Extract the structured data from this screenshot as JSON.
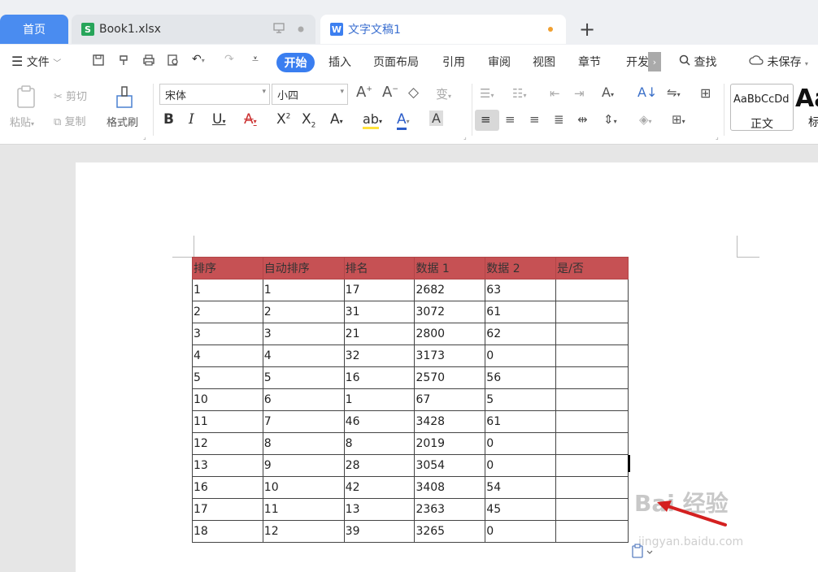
{
  "tabs": {
    "home": "首页",
    "book": "Book1.xlsx",
    "book_icon": "S",
    "doc": "文字文稿1",
    "doc_icon": "W",
    "new_tab": "+"
  },
  "menu": {
    "file": "文件",
    "items": [
      "开始",
      "插入",
      "页面布局",
      "引用",
      "审阅",
      "视图",
      "章节",
      "开发"
    ],
    "search": "查找",
    "save_status": "未保存"
  },
  "ribbon": {
    "paste": "粘贴",
    "cut": "剪切",
    "copy": "复制",
    "format_painter": "格式刷",
    "font_name": "宋体",
    "font_size": "小四",
    "style_sample": "AaBbCcDd",
    "style_name": "正文",
    "style_big": "Aa",
    "style_big_name": "标"
  },
  "table": {
    "headers": [
      "排序",
      "自动排序",
      "排名",
      "数据 1",
      "数据 2",
      "是/否"
    ],
    "rows": [
      [
        "1",
        "1",
        "17",
        "2682",
        "63",
        ""
      ],
      [
        "2",
        "2",
        "31",
        "3072",
        "61",
        ""
      ],
      [
        "3",
        "3",
        "21",
        "2800",
        "62",
        ""
      ],
      [
        "4",
        "4",
        "32",
        "3173",
        "0",
        ""
      ],
      [
        "5",
        "5",
        "16",
        "2570",
        "56",
        ""
      ],
      [
        "10",
        "6",
        "1",
        "67",
        "5",
        ""
      ],
      [
        "11",
        "7",
        "46",
        "3428",
        "61",
        ""
      ],
      [
        "12",
        "8",
        "8",
        "2019",
        "0",
        ""
      ],
      [
        "13",
        "9",
        "28",
        "3054",
        "0",
        ""
      ],
      [
        "16",
        "10",
        "42",
        "3408",
        "54",
        ""
      ],
      [
        "17",
        "11",
        "13",
        "2363",
        "45",
        ""
      ],
      [
        "18",
        "12",
        "39",
        "3265",
        "0",
        ""
      ]
    ]
  },
  "watermark": {
    "text": "Bai 经验",
    "url": "jingyan.baidu.com"
  },
  "colors": {
    "accent": "#3a7ef0",
    "home_tab": "#4a8cf0",
    "header_fill": "#c65154",
    "xls_icon": "#27a55a",
    "arrow": "#d42020"
  }
}
